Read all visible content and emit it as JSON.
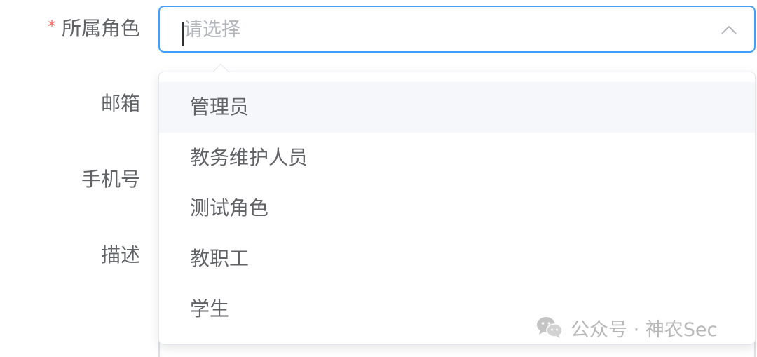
{
  "form": {
    "required_mark": "*",
    "labels": {
      "role": "所属角色",
      "email": "邮箱",
      "phone": "手机号",
      "description": "描述"
    },
    "role_select": {
      "placeholder": "请选择",
      "expanded": true
    }
  },
  "dropdown": {
    "hovered_index": 0,
    "options": [
      {
        "label": "管理员"
      },
      {
        "label": "教务维护人员"
      },
      {
        "label": "测试角色"
      },
      {
        "label": "教职工"
      },
      {
        "label": "学生"
      }
    ]
  },
  "watermark": {
    "text": "公众号 · 神农Sec",
    "icon": "wechat-icon"
  },
  "colors": {
    "focus_border": "#409eff",
    "required": "#f56c6c",
    "hover_bg": "#f5f7fa",
    "placeholder": "#b2b5bb",
    "label": "#606266"
  }
}
